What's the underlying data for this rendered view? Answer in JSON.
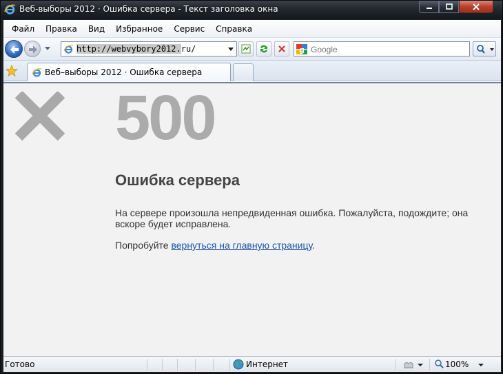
{
  "window": {
    "title": "Веб-выборы 2012 · Ошибка сервера - Текст заголовка окна",
    "min_label": "▁",
    "max_label": "▢",
    "close_label": "✕"
  },
  "menubar": {
    "items": [
      "Файл",
      "Правка",
      "Вид",
      "Избранное",
      "Сервис",
      "Справка"
    ]
  },
  "navbar": {
    "url": "http://webvybory2012.ru/",
    "search_placeholder": "Google"
  },
  "tabs": {
    "active_label": "Веб–выборы 2012 · Ошибка сервера"
  },
  "page": {
    "code": "500",
    "title": "Ошибка сервера",
    "message": "На сервере произошла непредвиденная ошибка. Пожалуйста, подождите; она вскоре будет исправлена.",
    "try_prefix": "Попробуйте ",
    "link_text": "вернуться на главную страницу",
    "try_suffix": "."
  },
  "statusbar": {
    "status": "Готово",
    "zone": "Интернет",
    "zoom": "100%"
  },
  "colors": {
    "accent_link": "#1f56a8",
    "code_gray": "#ababab",
    "content_bg": "#f2f2f2"
  },
  "icons": [
    "ie-icon",
    "back-icon",
    "forward-icon",
    "page-icon",
    "compat-icon",
    "refresh-icon",
    "stop-icon",
    "google-icon",
    "search-icon",
    "favorites-star-icon",
    "big-x-icon",
    "globe-icon",
    "lock-icon",
    "zoom-icon"
  ]
}
